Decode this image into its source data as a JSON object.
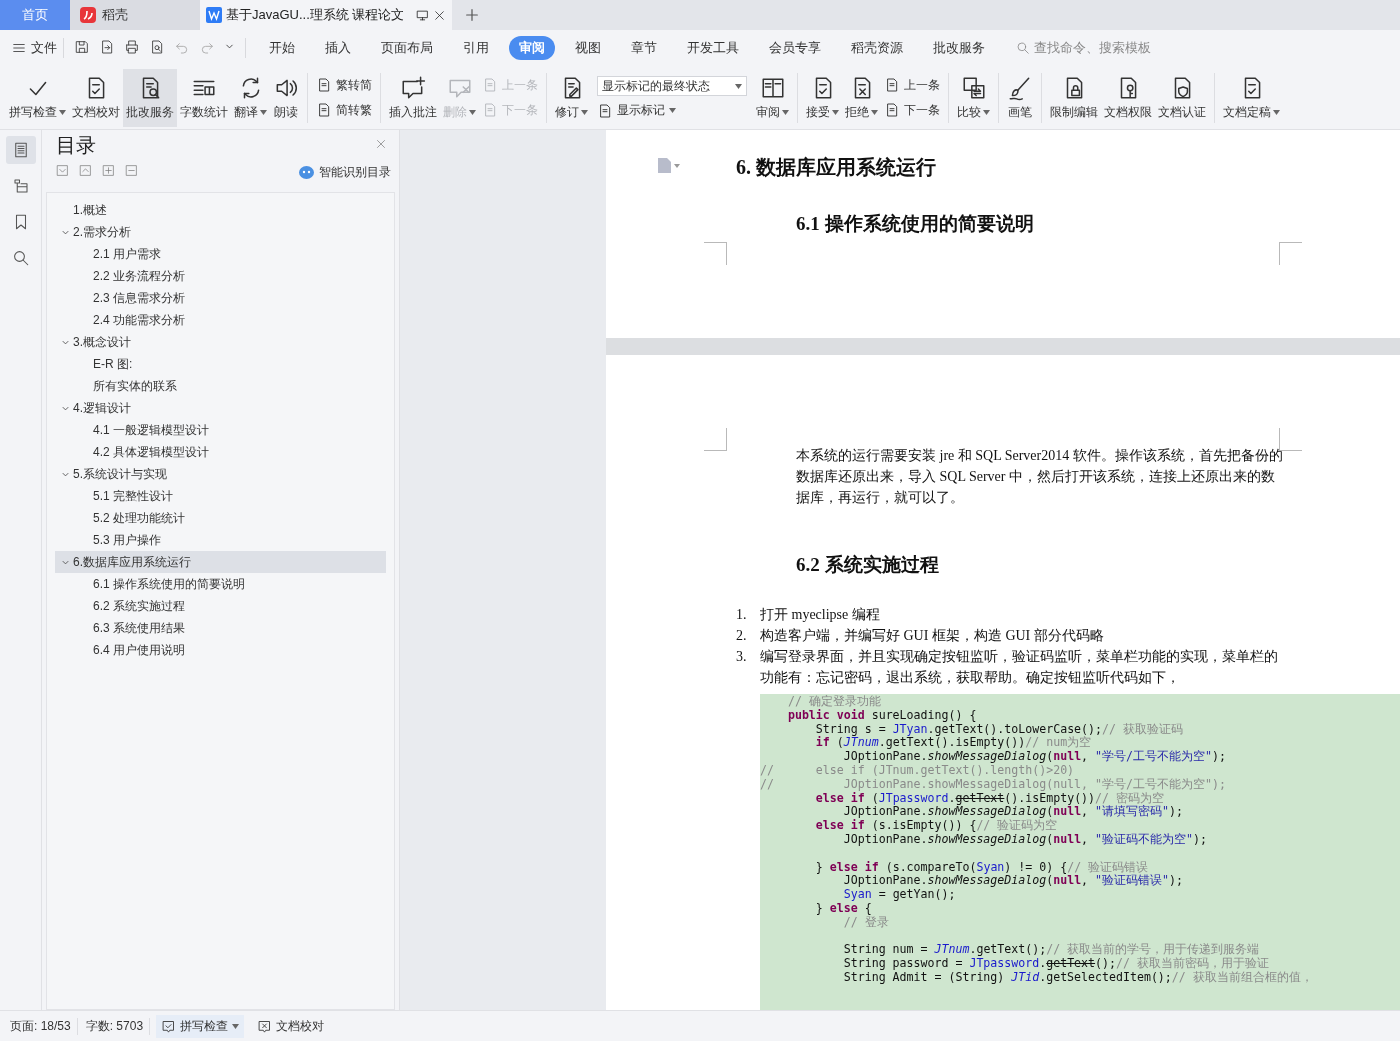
{
  "tabs": [
    {
      "label": "首页",
      "kind": "home",
      "selected": false
    },
    {
      "label": "稻壳",
      "kind": "app",
      "selected": false
    },
    {
      "label": "基于JavaGU...理系统 课程论文",
      "kind": "document",
      "selected": true
    }
  ],
  "menu": {
    "file": "文件",
    "tabs": [
      {
        "label": "开始",
        "selected": false
      },
      {
        "label": "插入",
        "selected": false
      },
      {
        "label": "页面布局",
        "selected": false
      },
      {
        "label": "引用",
        "selected": false
      },
      {
        "label": "审阅",
        "selected": true
      },
      {
        "label": "视图",
        "selected": false
      },
      {
        "label": "章节",
        "selected": false
      },
      {
        "label": "开发工具",
        "selected": false
      },
      {
        "label": "会员专享",
        "selected": false
      },
      {
        "label": "稻壳资源",
        "selected": false
      },
      {
        "label": "批改服务",
        "selected": false
      }
    ],
    "search": {
      "placeholder": "查找命令、搜索模板"
    }
  },
  "ribbon": [
    {
      "kind": "big",
      "label": "拼写检查",
      "dropdown": true,
      "disabled": false,
      "highlighted": false
    },
    {
      "kind": "big",
      "label": "文档校对",
      "dropdown": false,
      "disabled": false,
      "highlighted": false
    },
    {
      "kind": "big",
      "label": "批改服务",
      "dropdown": false,
      "disabled": false,
      "highlighted": true
    },
    {
      "kind": "big",
      "label": "字数统计",
      "dropdown": false,
      "disabled": false,
      "highlighted": false
    },
    {
      "kind": "big",
      "label": "翻译",
      "dropdown": true,
      "disabled": false,
      "highlighted": false
    },
    {
      "kind": "big",
      "label": "朗读",
      "dropdown": false,
      "disabled": false,
      "highlighted": false
    },
    {
      "kind": "separator"
    },
    {
      "kind": "stack",
      "items": [
        {
          "label": "繁转简",
          "disabled": false
        },
        {
          "label": "简转繁",
          "disabled": false
        }
      ]
    },
    {
      "kind": "separator"
    },
    {
      "kind": "big",
      "label": "插入批注",
      "dropdown": false,
      "disabled": false,
      "highlighted": false
    },
    {
      "kind": "big",
      "label": "删除",
      "dropdown": true,
      "disabled": true,
      "highlighted": false
    },
    {
      "kind": "stack",
      "items": [
        {
          "label": "上一条",
          "disabled": true
        },
        {
          "label": "下一条",
          "disabled": true
        }
      ]
    },
    {
      "kind": "separator"
    },
    {
      "kind": "big",
      "label": "修订",
      "dropdown": true,
      "disabled": false,
      "highlighted": false
    },
    {
      "kind": "select",
      "value": "显示标记的最终状态",
      "label": "显示标记"
    },
    {
      "kind": "big",
      "label": "审阅",
      "dropdown": true,
      "disabled": false,
      "highlighted": false
    },
    {
      "kind": "separator"
    },
    {
      "kind": "big",
      "label": "接受",
      "dropdown": true,
      "disabled": false,
      "highlighted": false
    },
    {
      "kind": "big",
      "label": "拒绝",
      "dropdown": true,
      "disabled": false,
      "highlighted": false
    },
    {
      "kind": "stack",
      "items": [
        {
          "label": "上一条",
          "disabled": false
        },
        {
          "label": "下一条",
          "disabled": false
        }
      ]
    },
    {
      "kind": "separator"
    },
    {
      "kind": "big",
      "label": "比较",
      "dropdown": true,
      "disabled": false,
      "highlighted": false
    },
    {
      "kind": "separator"
    },
    {
      "kind": "big",
      "label": "画笔",
      "dropdown": false,
      "disabled": false,
      "highlighted": false
    },
    {
      "kind": "separator"
    },
    {
      "kind": "big",
      "label": "限制编辑",
      "dropdown": false,
      "disabled": false,
      "highlighted": false
    },
    {
      "kind": "big",
      "label": "文档权限",
      "dropdown": false,
      "disabled": false,
      "highlighted": false
    },
    {
      "kind": "big",
      "label": "文档认证",
      "dropdown": false,
      "disabled": false,
      "highlighted": false
    },
    {
      "kind": "separator"
    },
    {
      "kind": "big",
      "label": "文档定稿",
      "dropdown": true,
      "disabled": false,
      "highlighted": false
    }
  ],
  "toc": {
    "title": "目录",
    "smart_button": "智能识别目录",
    "items": [
      {
        "label": "1.概述",
        "selected": false
      },
      {
        "label": "2.需求分析",
        "selected": false,
        "expanded": true,
        "children": [
          {
            "label": "2.1 用户需求",
            "selected": false
          },
          {
            "label": "2.2 业务流程分析",
            "selected": false
          },
          {
            "label": "2.3 信息需求分析",
            "selected": false
          },
          {
            "label": "2.4 功能需求分析",
            "selected": false
          }
        ]
      },
      {
        "label": "3.概念设计",
        "selected": false,
        "expanded": true,
        "children": [
          {
            "label": "E-R 图:",
            "selected": false
          },
          {
            "label": "所有实体的联系",
            "selected": false
          }
        ]
      },
      {
        "label": "4.逻辑设计",
        "selected": false,
        "expanded": true,
        "children": [
          {
            "label": "4.1 一般逻辑模型设计",
            "selected": false
          },
          {
            "label": "4.2 具体逻辑模型设计",
            "selected": false
          }
        ]
      },
      {
        "label": "5.系统设计与实现",
        "selected": false,
        "expanded": true,
        "children": [
          {
            "label": "5.1 完整性设计",
            "selected": false
          },
          {
            "label": "5.2 处理功能统计",
            "selected": false
          },
          {
            "label": "5.3 用户操作",
            "selected": false
          }
        ]
      },
      {
        "label": "6.数据库应用系统运行",
        "selected": true,
        "expanded": true,
        "children": [
          {
            "label": "6.1 操作系统使用的简要说明",
            "selected": false
          },
          {
            "label": "6.2 系统实施过程",
            "selected": false
          },
          {
            "label": "6.3 系统使用结果",
            "selected": false
          },
          {
            "label": "6.4 用户使用说明",
            "selected": false
          }
        ]
      }
    ]
  },
  "document": {
    "heading_1": "6. 数据库应用系统运行",
    "heading_2": "6.1 操作系统使用的简要说明",
    "paragraph": "本系统的运行需要安装 jre 和 SQL Server2014 软件。操作该系统，首先把备份的数据库还原出来，导入 SQL Server 中，然后打开该系统，连接上还原出来的数据库，再运行，就可以了。",
    "heading_3": "6.2 系统实施过程",
    "list": [
      {
        "number": "1.",
        "text": "打开 myeclipse 编程"
      },
      {
        "number": "2.",
        "text": "构造客户端，并编写好 GUI 框架，构造 GUI 部分代码略"
      },
      {
        "number": "3.",
        "text": "编写登录界面，并且实现确定按钮监听，验证码监听，菜单栏功能的实现，菜单栏的功能有：忘记密码，退出系统，获取帮助。确定按钮监听代码如下，"
      }
    ],
    "code": [
      {
        "kind": "code",
        "segments": [
          {
            "text": "    // 确定登录功能",
            "kind": "comment"
          }
        ]
      },
      {
        "kind": "code",
        "segments": [
          {
            "text": "    public void",
            "kind": "keyword"
          },
          {
            "text": " sureLoading() {",
            "kind": "plain"
          }
        ]
      },
      {
        "kind": "code",
        "segments": [
          {
            "text": "        String s = ",
            "kind": "plain"
          },
          {
            "text": "JTyan",
            "kind": "field"
          },
          {
            "text": ".getText().toLowerCase();",
            "kind": "plain"
          },
          {
            "text": "// 获取验证码",
            "kind": "comment"
          }
        ]
      },
      {
        "kind": "code",
        "segments": [
          {
            "text": "        if",
            "kind": "keyword"
          },
          {
            "text": " (",
            "kind": "plain"
          },
          {
            "text": "JTnum",
            "kind": "static"
          },
          {
            "text": ".getText().isEmpty())",
            "kind": "plain"
          },
          {
            "text": "// num为空",
            "kind": "comment"
          }
        ]
      },
      {
        "kind": "code",
        "segments": [
          {
            "text": "            JOptionPane.",
            "kind": "plain"
          },
          {
            "text": "showMessageDialog",
            "kind": "italic"
          },
          {
            "text": "(",
            "kind": "plain"
          },
          {
            "text": "null",
            "kind": "keyword"
          },
          {
            "text": ", ",
            "kind": "plain"
          },
          {
            "text": "\"学号/工号不能为空\"",
            "kind": "string"
          },
          {
            "text": ");",
            "kind": "plain"
          }
        ]
      },
      {
        "kind": "code",
        "segments": [
          {
            "text": "//      else if (JTnum.getText().length()>20)",
            "kind": "comment"
          }
        ]
      },
      {
        "kind": "code",
        "segments": [
          {
            "text": "//          JOptionPane.showMessageDialog(null, \"学号/工号不能为空\");",
            "kind": "comment"
          }
        ]
      },
      {
        "kind": "code",
        "segments": [
          {
            "text": "        else if",
            "kind": "keyword"
          },
          {
            "text": " (",
            "kind": "plain"
          },
          {
            "text": "JTpassword",
            "kind": "field"
          },
          {
            "text": ".",
            "kind": "plain"
          },
          {
            "text": "getText",
            "kind": "strike"
          },
          {
            "text": "().isEmpty())",
            "kind": "plain"
          },
          {
            "text": "// 密码为空",
            "kind": "comment"
          }
        ]
      },
      {
        "kind": "code",
        "segments": [
          {
            "text": "            JOptionPane.",
            "kind": "plain"
          },
          {
            "text": "showMessageDialog",
            "kind": "italic"
          },
          {
            "text": "(",
            "kind": "plain"
          },
          {
            "text": "null",
            "kind": "keyword"
          },
          {
            "text": ", ",
            "kind": "plain"
          },
          {
            "text": "\"请填写密码\"",
            "kind": "string"
          },
          {
            "text": ");",
            "kind": "plain"
          }
        ]
      },
      {
        "kind": "code",
        "segments": [
          {
            "text": "        else if",
            "kind": "keyword"
          },
          {
            "text": " (s.isEmpty()) {",
            "kind": "plain"
          },
          {
            "text": "// 验证码为空",
            "kind": "comment"
          }
        ]
      },
      {
        "kind": "code",
        "segments": [
          {
            "text": "            JOptionPane.",
            "kind": "plain"
          },
          {
            "text": "showMessageDialog",
            "kind": "italic"
          },
          {
            "text": "(",
            "kind": "plain"
          },
          {
            "text": "null",
            "kind": "keyword"
          },
          {
            "text": ", ",
            "kind": "plain"
          },
          {
            "text": "\"验证码不能为空\"",
            "kind": "string"
          },
          {
            "text": ");",
            "kind": "plain"
          }
        ]
      },
      {
        "kind": "blank"
      },
      {
        "kind": "code",
        "segments": [
          {
            "text": "        } ",
            "kind": "plain"
          },
          {
            "text": "else if",
            "kind": "keyword"
          },
          {
            "text": " (s.compareTo(",
            "kind": "plain"
          },
          {
            "text": "Syan",
            "kind": "field"
          },
          {
            "text": ") != 0) {",
            "kind": "plain"
          },
          {
            "text": "// 验证码错误",
            "kind": "comment"
          }
        ]
      },
      {
        "kind": "code",
        "segments": [
          {
            "text": "            JOptionPane.",
            "kind": "plain"
          },
          {
            "text": "showMessageDialog",
            "kind": "italic"
          },
          {
            "text": "(",
            "kind": "plain"
          },
          {
            "text": "null",
            "kind": "keyword"
          },
          {
            "text": ", ",
            "kind": "plain"
          },
          {
            "text": "\"验证码错误\"",
            "kind": "string"
          },
          {
            "text": ");",
            "kind": "plain"
          }
        ]
      },
      {
        "kind": "code",
        "segments": [
          {
            "text": "            Syan",
            "kind": "field"
          },
          {
            "text": " = getYan();",
            "kind": "plain"
          }
        ]
      },
      {
        "kind": "code",
        "segments": [
          {
            "text": "        } ",
            "kind": "plain"
          },
          {
            "text": "else",
            "kind": "keyword"
          },
          {
            "text": " {",
            "kind": "plain"
          }
        ]
      },
      {
        "kind": "code",
        "segments": [
          {
            "text": "            // 登录",
            "kind": "comment"
          }
        ]
      },
      {
        "kind": "blank"
      },
      {
        "kind": "code",
        "segments": [
          {
            "text": "            String num = ",
            "kind": "plain"
          },
          {
            "text": "JTnum",
            "kind": "static"
          },
          {
            "text": ".getText();",
            "kind": "plain"
          },
          {
            "text": "// 获取当前的学号，用于传递到服务端",
            "kind": "comment"
          }
        ]
      },
      {
        "kind": "code",
        "segments": [
          {
            "text": "            String password = ",
            "kind": "plain"
          },
          {
            "text": "JTpassword",
            "kind": "field"
          },
          {
            "text": ".",
            "kind": "plain"
          },
          {
            "text": "getText",
            "kind": "strike"
          },
          {
            "text": "();",
            "kind": "plain"
          },
          {
            "text": "// 获取当前密码，用于验证",
            "kind": "comment"
          }
        ]
      },
      {
        "kind": "code",
        "segments": [
          {
            "text": "            String Admit = (String) ",
            "kind": "plain"
          },
          {
            "text": "JTid",
            "kind": "static"
          },
          {
            "text": ".getSelectedItem();",
            "kind": "plain"
          },
          {
            "text": "// 获取当前组合框的值，",
            "kind": "comment"
          }
        ]
      }
    ]
  },
  "status_bar": {
    "page": "页面: 18/53",
    "words": "字数: 5703",
    "buttons": [
      {
        "label": "拼写检查",
        "dropdown": true,
        "highlighted": true
      },
      {
        "label": "文档校对",
        "dropdown": false,
        "highlighted": false
      }
    ]
  }
}
